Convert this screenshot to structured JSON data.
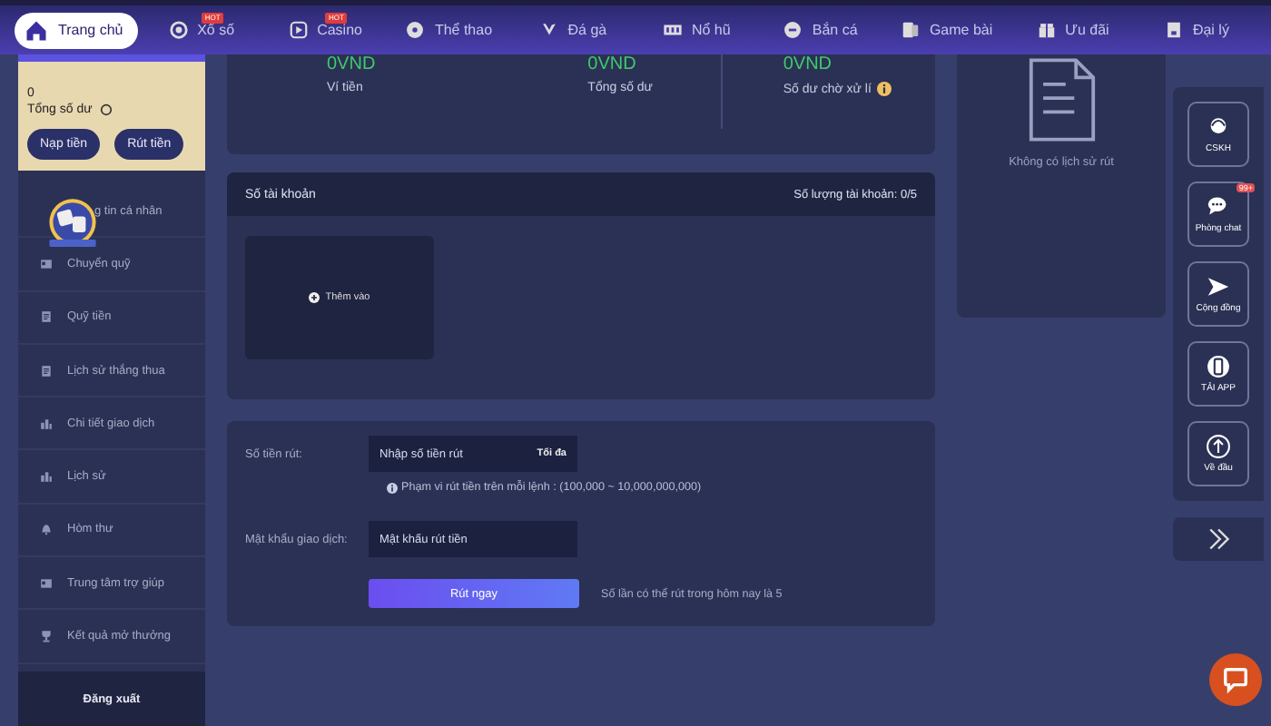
{
  "nav": [
    {
      "label": "Trang chủ",
      "selected": true
    },
    {
      "label": "Xổ số",
      "selected": false,
      "badge": "HOT"
    },
    {
      "label": "Casino",
      "selected": false,
      "badge": "HOT"
    },
    {
      "label": "Thể thao",
      "selected": false
    },
    {
      "label": "Đá gà",
      "selected": false
    },
    {
      "label": "Nổ hũ",
      "selected": false
    },
    {
      "label": "Bắn cá",
      "selected": false
    },
    {
      "label": "Game bài",
      "selected": false
    },
    {
      "label": "Ưu đãi",
      "selected": false
    },
    {
      "label": "Đại lý",
      "selected": false
    }
  ],
  "wallet": {
    "amount": "0",
    "label": "Tổng số dư",
    "buttons": [
      "Nạp tiền",
      "Rút tiền"
    ]
  },
  "menu": [
    "g tin cá nhân",
    "Chuyển quỹ",
    "Quỹ tiền",
    "Lịch sử thắng thua",
    "Chi tiết giao dịch",
    "Lịch sử",
    "Hòm thư",
    "Trung tâm trợ giúp",
    "Kết quả mở thưởng"
  ],
  "logout": "Đăng xuất",
  "stats": [
    {
      "value": "0VND",
      "label": "Ví tiền",
      "info": false
    },
    {
      "value": "0VND",
      "label": "Tổng số dư",
      "info": false
    },
    {
      "value": "0VND",
      "label": "Số dư chờ xử lí",
      "info": true
    }
  ],
  "accounts": {
    "title": "Số tài khoản",
    "count_label": "Số lượng tài khoản:",
    "count": "0/5",
    "add": "Thêm vào"
  },
  "withdraw": {
    "amount_label": "Số tiền rút:",
    "amount_placeholder": "Nhập số tiền rút",
    "max": "Tối đa",
    "range_note": "Phạm vi rút tiền trên mỗi lệnh : (100,000 ~ 10,000,000,000)",
    "password_label": "Mật khẩu giao dịch:",
    "password_placeholder": "Mật khẩu rút tiền",
    "submit": "Rút ngay",
    "remaining": "Số lần có thể rút trong hôm nay là 5"
  },
  "history": {
    "empty": "Không có lịch sử rút"
  },
  "side_tools": [
    {
      "label": "CSKH"
    },
    {
      "label": "Phòng chat",
      "badge": "99+"
    },
    {
      "label": "Cộng đồng"
    },
    {
      "label": "TẢI APP"
    },
    {
      "label": "Về đầu"
    }
  ]
}
